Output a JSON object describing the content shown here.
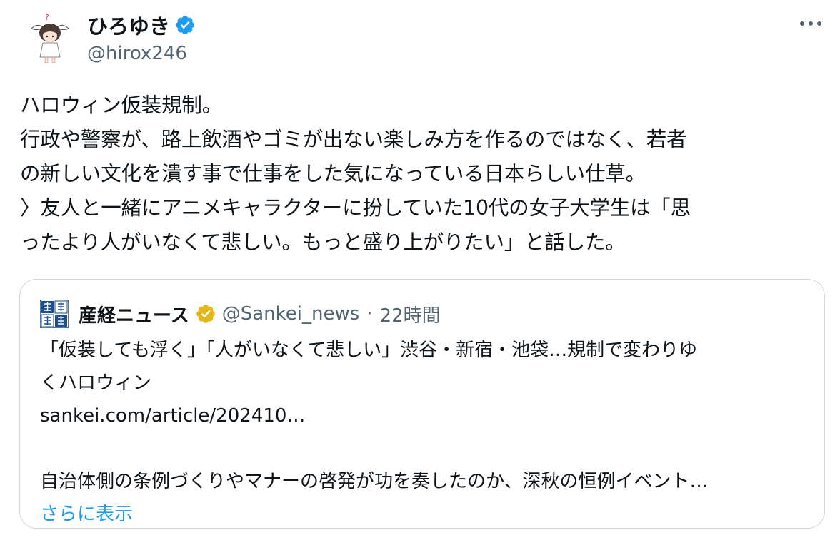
{
  "tweet": {
    "author": {
      "display_name": "ひろゆき",
      "handle": "@hirox246",
      "verified": true,
      "verified_badge_color": "#1d9bf0",
      "avatar_icon": "cartoon-character-avatar"
    },
    "more_icon": "ellipsis-horizontal-icon",
    "text_lines": [
      "ハロウィン仮装規制。",
      "行政や警察が、路上飲酒やゴミが出ない楽しみ方を作るのではなく、若者",
      "の新しい文化を潰す事で仕事をした気になっている日本らしい仕草。",
      "〉友人と一緒にアニメキャラクターに扮していた10代の女子大学生は「思",
      "ったより人がいなくて悲しい。もっと盛り上がりたい」と話した。"
    ],
    "quote": {
      "logo_icon": "sankei-shimbun-logo",
      "display_name": "産経ニュース",
      "verified_badge": "gold-verified-badge-icon",
      "verified_badge_color": "#e2b719",
      "handle": "@Sankei_news",
      "separator": "·",
      "time": "22時間",
      "text_lines": [
        "「仮装しても浮く」「人がいなくて悲しい」渋谷・新宿・池袋…規制で変わりゆ",
        "くハロウィン",
        "sankei.com/article/202410…",
        "",
        "自治体側の条例づくりやマナーの啓発が功を奏したのか、深秋の恒例イベント…"
      ],
      "show_more": "さらに表示",
      "link_color": "#1d9bf0"
    }
  },
  "colors": {
    "text_primary": "#0f1419",
    "text_secondary": "#536471",
    "border": "#cfd9de"
  }
}
